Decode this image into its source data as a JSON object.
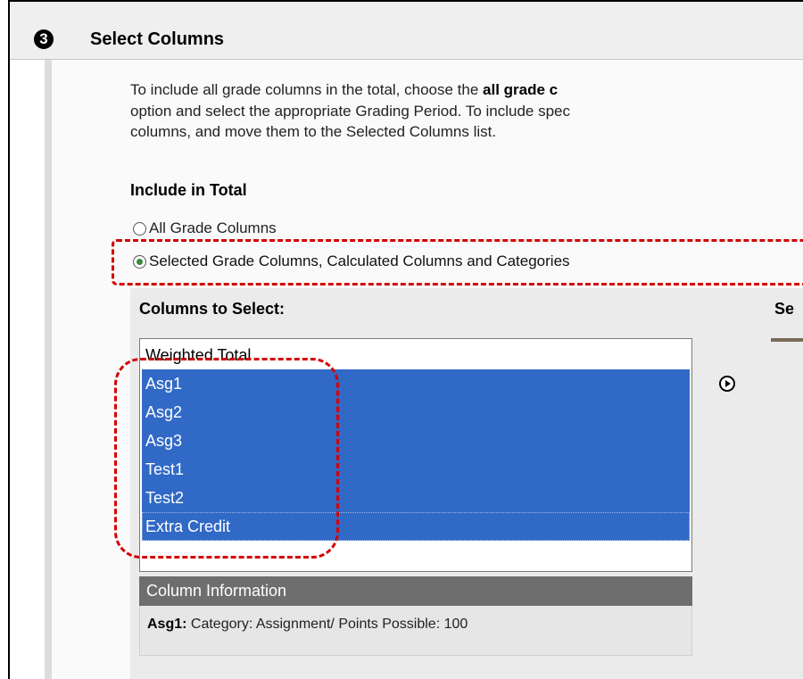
{
  "step": {
    "number": "3",
    "title": "Select Columns"
  },
  "instructions": {
    "line1_pre": "To include all grade columns in the total, choose the ",
    "line1_bold": "all grade c",
    "line2": "option and select the appropriate Grading Period. To include spec",
    "line3": "columns, and move them to the Selected Columns list."
  },
  "include_in_total": {
    "label": "Include in Total",
    "options": [
      {
        "label": "All Grade Columns",
        "checked": false
      },
      {
        "label": "Selected Grade Columns, Calculated Columns and Categories",
        "checked": true
      }
    ]
  },
  "columns_to_select": {
    "header": "Columns to Select:",
    "items": [
      {
        "label": "Weighted Total",
        "selected": false
      },
      {
        "label": "Asg1",
        "selected": true
      },
      {
        "label": "Asg2",
        "selected": true
      },
      {
        "label": "Asg3",
        "selected": true
      },
      {
        "label": "Test1",
        "selected": true
      },
      {
        "label": "Test2",
        "selected": true
      },
      {
        "label": "Extra Credit",
        "selected": true
      }
    ]
  },
  "selected_columns": {
    "header": "Se"
  },
  "move_button_icon": "right-arrow-circle-icon",
  "column_information": {
    "header": "Column Information",
    "name": "Asg1:",
    "details": " Category: Assignment/ Points Possible: 100"
  },
  "colors": {
    "selection": "#3169c6",
    "callout": "#d40000",
    "info_bar": "#6e6e6e"
  }
}
